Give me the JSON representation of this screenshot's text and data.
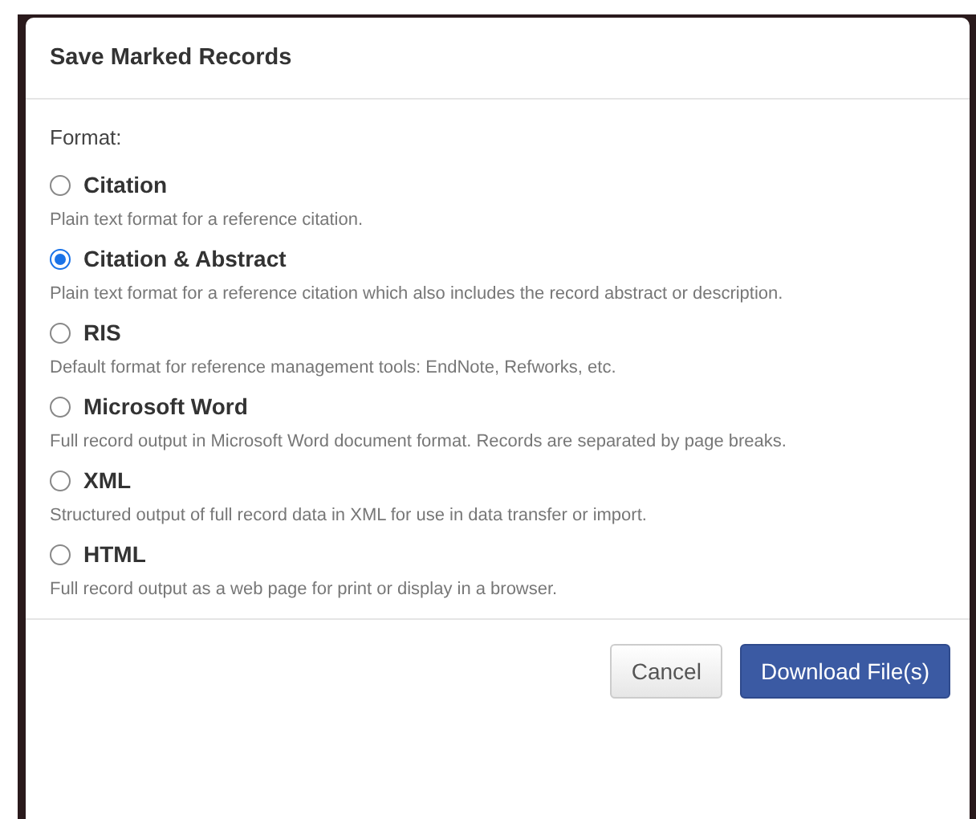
{
  "dialog": {
    "title": "Save Marked Records",
    "format_label": "Format:",
    "options": [
      {
        "label": "Citation",
        "description": "Plain text format for a reference citation.",
        "selected": false
      },
      {
        "label": "Citation & Abstract",
        "description": "Plain text format for a reference citation which also includes the record abstract or description.",
        "selected": true
      },
      {
        "label": "RIS",
        "description": "Default format for reference management tools: EndNote, Refworks, etc.",
        "selected": false
      },
      {
        "label": "Microsoft Word",
        "description": "Full record output in Microsoft Word document format. Records are separated by page breaks.",
        "selected": false
      },
      {
        "label": "XML",
        "description": "Structured output of full record data in XML for use in data transfer or import.",
        "selected": false
      },
      {
        "label": "HTML",
        "description": "Full record output as a web page for print or display in a browser.",
        "selected": false
      }
    ],
    "buttons": [
      {
        "label": "Cancel",
        "kind": "secondary"
      },
      {
        "label": "Download File(s)",
        "kind": "primary"
      }
    ]
  }
}
